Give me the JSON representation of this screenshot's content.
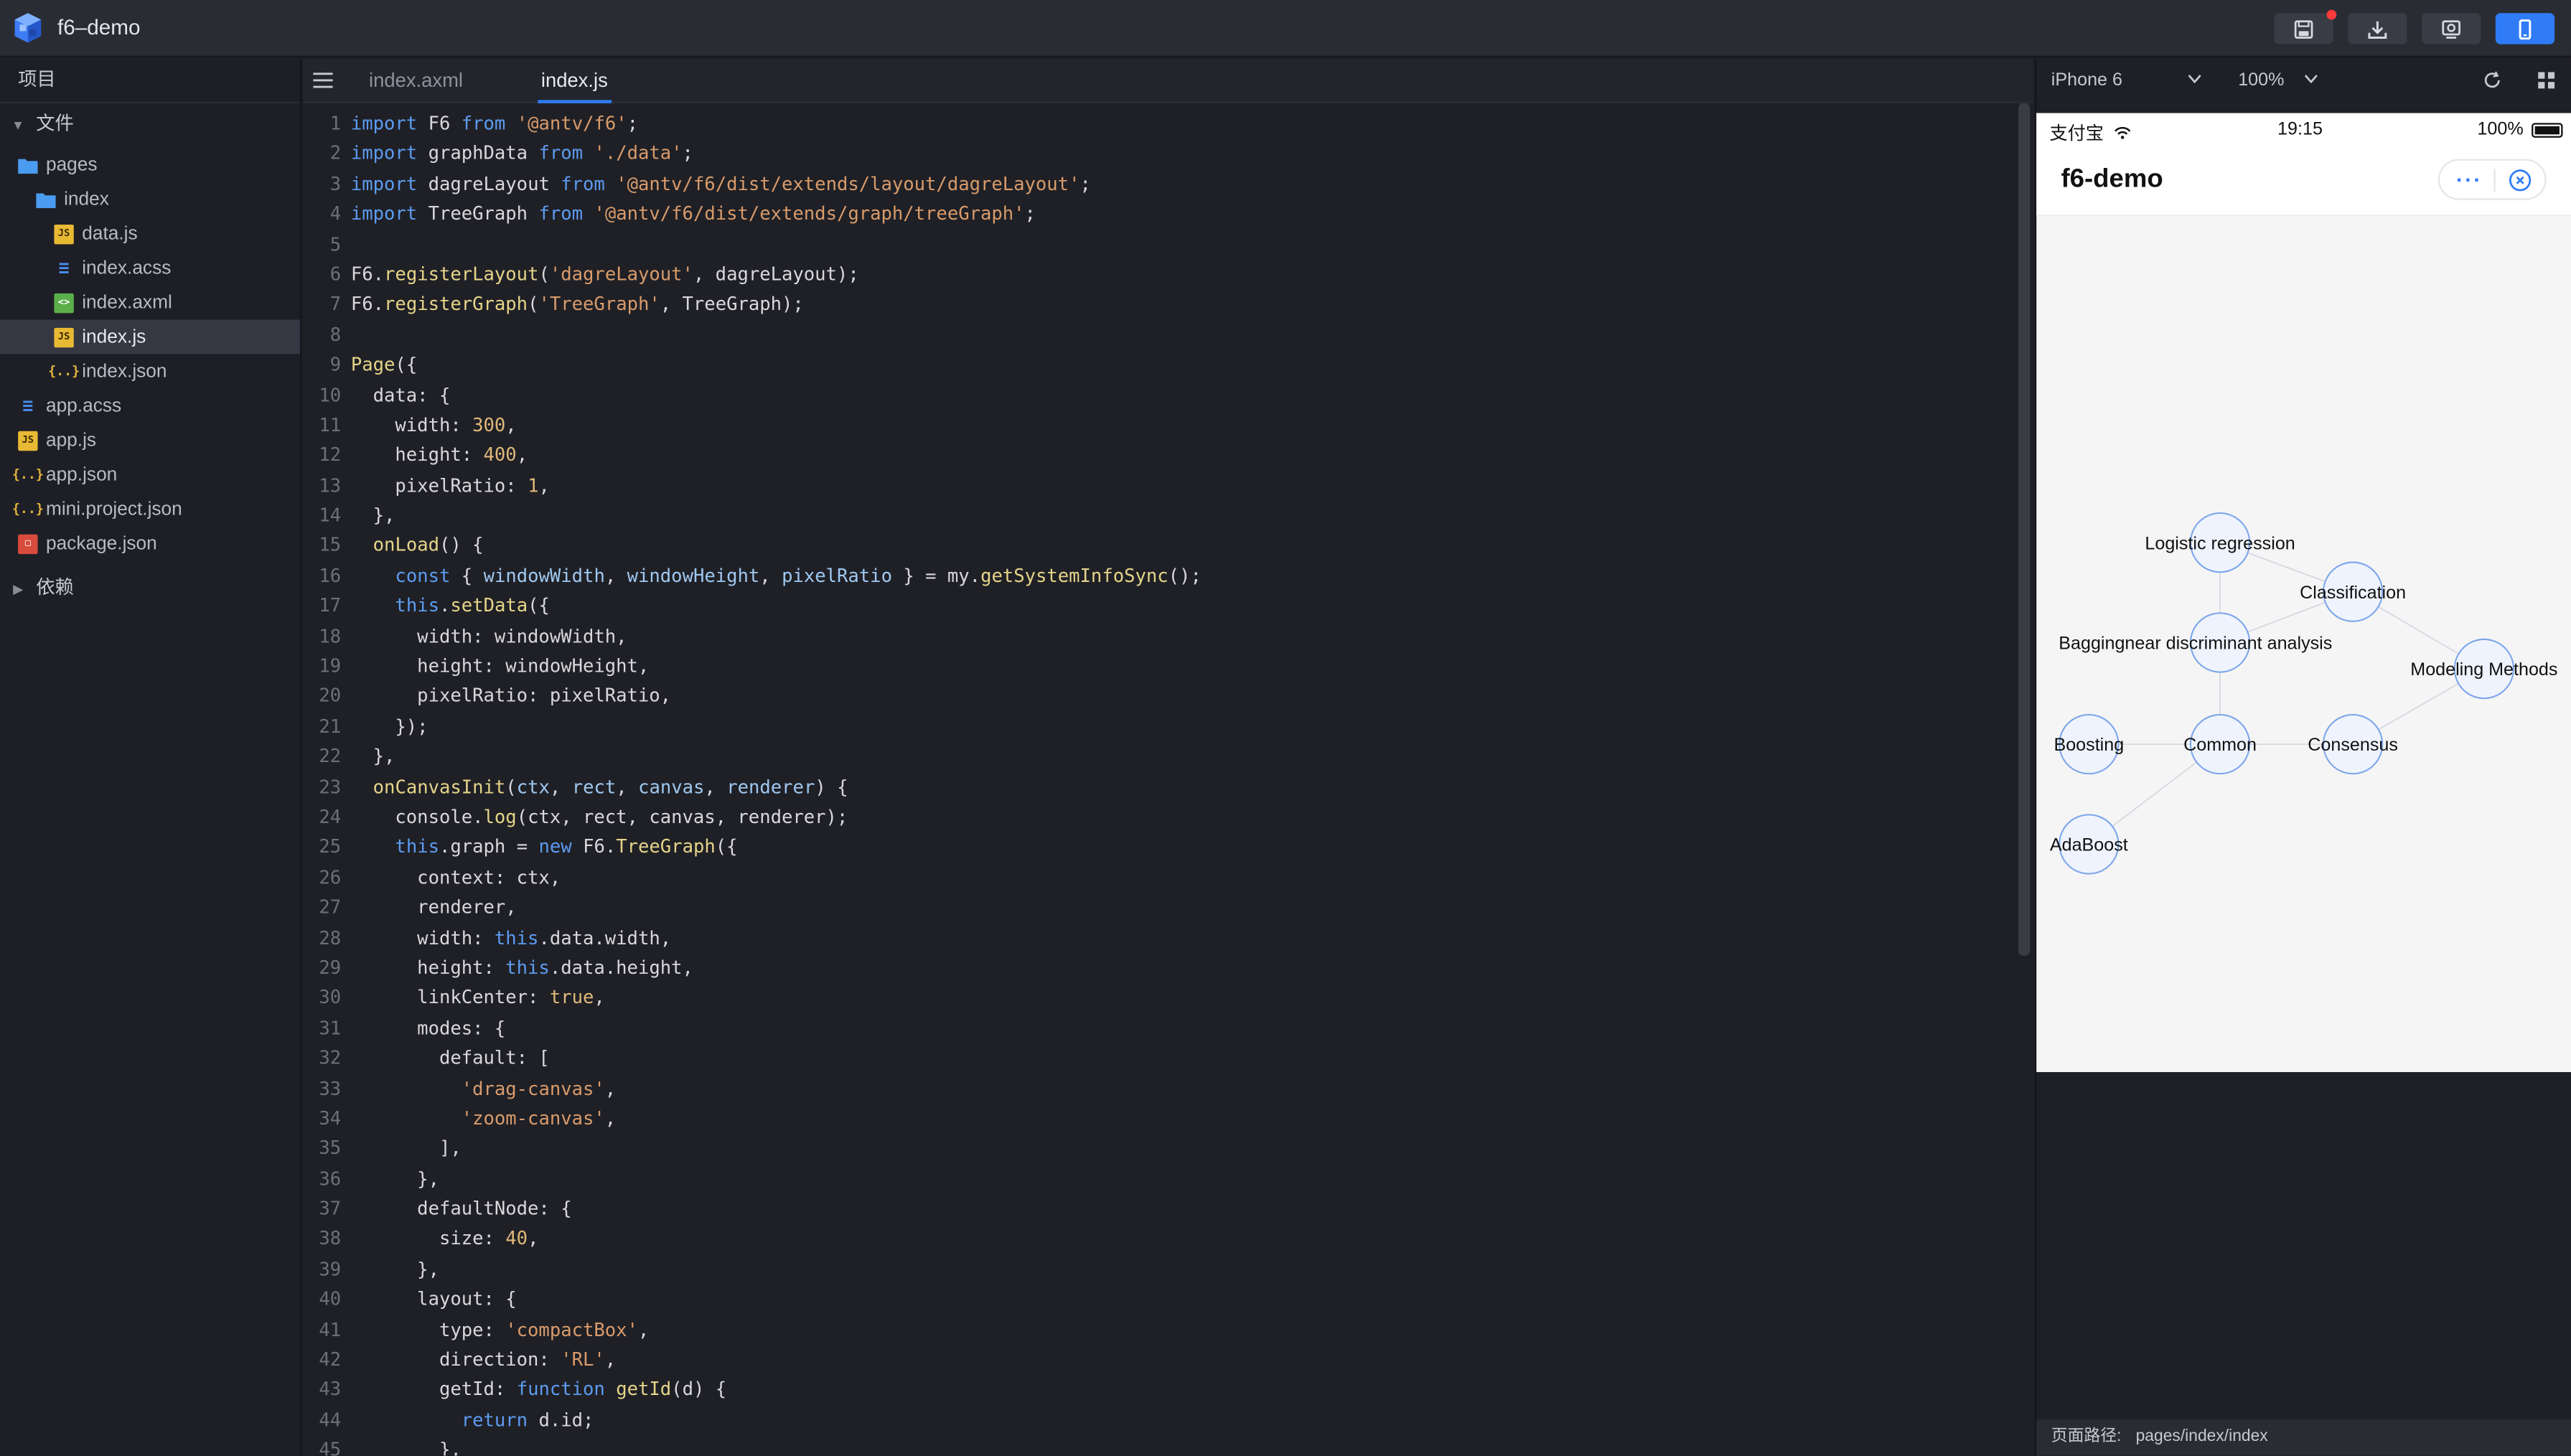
{
  "app": {
    "title": "f6–demo"
  },
  "sidebar": {
    "header": "项目",
    "files_section": "文件",
    "deps_section": "依赖",
    "items": [
      {
        "label": "pages",
        "icon": "folder-icon",
        "depth": 0
      },
      {
        "label": "index",
        "icon": "folder-icon",
        "depth": 1
      },
      {
        "label": "data.js",
        "icon": "js-file-icon",
        "depth": 2
      },
      {
        "label": "index.acss",
        "icon": "css-file-icon",
        "depth": 2
      },
      {
        "label": "index.axml",
        "icon": "axml-file-icon",
        "depth": 2
      },
      {
        "label": "index.js",
        "icon": "js-file-icon",
        "depth": 2,
        "selected": true
      },
      {
        "label": "index.json",
        "icon": "json-file-icon",
        "depth": 2
      },
      {
        "label": "app.acss",
        "icon": "css-file-icon",
        "depth": 0
      },
      {
        "label": "app.js",
        "icon": "js-file-icon",
        "depth": 0
      },
      {
        "label": "app.json",
        "icon": "json-file-icon",
        "depth": 0
      },
      {
        "label": "mini.project.json",
        "icon": "json-file-icon",
        "depth": 0
      },
      {
        "label": "package.json",
        "icon": "package-file-icon",
        "depth": 0
      }
    ]
  },
  "editor": {
    "tabs": [
      {
        "label": "index.axml",
        "active": false
      },
      {
        "label": "index.js",
        "active": true
      }
    ],
    "lines": [
      [
        [
          "k",
          "import"
        ],
        [
          "p",
          " F6 "
        ],
        [
          "k",
          "from"
        ],
        [
          "p",
          " "
        ],
        [
          "s",
          "'@antv/f6'"
        ],
        [
          "p",
          ";"
        ]
      ],
      [
        [
          "k",
          "import"
        ],
        [
          "p",
          " graphData "
        ],
        [
          "k",
          "from"
        ],
        [
          "p",
          " "
        ],
        [
          "s",
          "'./data'"
        ],
        [
          "p",
          ";"
        ]
      ],
      [
        [
          "k",
          "import"
        ],
        [
          "p",
          " dagreLayout "
        ],
        [
          "k",
          "from"
        ],
        [
          "p",
          " "
        ],
        [
          "s",
          "'@antv/f6/dist/extends/layout/dagreLayout'"
        ],
        [
          "p",
          ";"
        ]
      ],
      [
        [
          "k",
          "import"
        ],
        [
          "p",
          " TreeGraph "
        ],
        [
          "k",
          "from"
        ],
        [
          "p",
          " "
        ],
        [
          "s",
          "'@antv/f6/dist/extends/graph/treeGraph'"
        ],
        [
          "p",
          ";"
        ]
      ],
      [],
      [
        [
          "p",
          "F6."
        ],
        [
          "f",
          "registerLayout"
        ],
        [
          "p",
          "("
        ],
        [
          "s",
          "'dagreLayout'"
        ],
        [
          "p",
          ", dagreLayout);"
        ]
      ],
      [
        [
          "p",
          "F6."
        ],
        [
          "f",
          "registerGraph"
        ],
        [
          "p",
          "("
        ],
        [
          "s",
          "'TreeGraph'"
        ],
        [
          "p",
          ", TreeGraph);"
        ]
      ],
      [],
      [
        [
          "f",
          "Page"
        ],
        [
          "p",
          "({"
        ]
      ],
      [
        [
          "p",
          "  data: {"
        ]
      ],
      [
        [
          "p",
          "    width: "
        ],
        [
          "n",
          "300"
        ],
        [
          "p",
          ","
        ]
      ],
      [
        [
          "p",
          "    height: "
        ],
        [
          "n",
          "400"
        ],
        [
          "p",
          ","
        ]
      ],
      [
        [
          "p",
          "    pixelRatio: "
        ],
        [
          "n",
          "1"
        ],
        [
          "p",
          ","
        ]
      ],
      [
        [
          "p",
          "  },"
        ]
      ],
      [
        [
          "p",
          "  "
        ],
        [
          "f",
          "onLoad"
        ],
        [
          "p",
          "() {"
        ]
      ],
      [
        [
          "p",
          "    "
        ],
        [
          "k",
          "const"
        ],
        [
          "p",
          " { "
        ],
        [
          "v",
          "windowWidth"
        ],
        [
          "p",
          ", "
        ],
        [
          "v",
          "windowHeight"
        ],
        [
          "p",
          ", "
        ],
        [
          "v",
          "pixelRatio"
        ],
        [
          "p",
          " } = my."
        ],
        [
          "f",
          "getSystemInfoSync"
        ],
        [
          "p",
          "();"
        ]
      ],
      [
        [
          "p",
          "    "
        ],
        [
          "k",
          "this"
        ],
        [
          "p",
          "."
        ],
        [
          "f",
          "setData"
        ],
        [
          "p",
          "({"
        ]
      ],
      [
        [
          "p",
          "      width: windowWidth,"
        ]
      ],
      [
        [
          "p",
          "      height: windowHeight,"
        ]
      ],
      [
        [
          "p",
          "      pixelRatio: pixelRatio,"
        ]
      ],
      [
        [
          "p",
          "    });"
        ]
      ],
      [
        [
          "p",
          "  },"
        ]
      ],
      [
        [
          "p",
          "  "
        ],
        [
          "f",
          "onCanvasInit"
        ],
        [
          "p",
          "("
        ],
        [
          "v",
          "ctx"
        ],
        [
          "p",
          ", "
        ],
        [
          "v",
          "rect"
        ],
        [
          "p",
          ", "
        ],
        [
          "v",
          "canvas"
        ],
        [
          "p",
          ", "
        ],
        [
          "v",
          "renderer"
        ],
        [
          "p",
          ") {"
        ]
      ],
      [
        [
          "p",
          "    console."
        ],
        [
          "f",
          "log"
        ],
        [
          "p",
          "(ctx, rect, canvas, renderer);"
        ]
      ],
      [
        [
          "p",
          "    "
        ],
        [
          "k",
          "this"
        ],
        [
          "p",
          ".graph = "
        ],
        [
          "k",
          "new"
        ],
        [
          "p",
          " F6."
        ],
        [
          "f",
          "TreeGraph"
        ],
        [
          "p",
          "({"
        ]
      ],
      [
        [
          "p",
          "      context: ctx,"
        ]
      ],
      [
        [
          "p",
          "      renderer,"
        ]
      ],
      [
        [
          "p",
          "      width: "
        ],
        [
          "k",
          "this"
        ],
        [
          "p",
          ".data.width,"
        ]
      ],
      [
        [
          "p",
          "      height: "
        ],
        [
          "k",
          "this"
        ],
        [
          "p",
          ".data.height,"
        ]
      ],
      [
        [
          "p",
          "      linkCenter: "
        ],
        [
          "n",
          "true"
        ],
        [
          "p",
          ","
        ]
      ],
      [
        [
          "p",
          "      modes: {"
        ]
      ],
      [
        [
          "p",
          "        default: ["
        ]
      ],
      [
        [
          "p",
          "          "
        ],
        [
          "s",
          "'drag-canvas'"
        ],
        [
          "p",
          ","
        ]
      ],
      [
        [
          "p",
          "          "
        ],
        [
          "s",
          "'zoom-canvas'"
        ],
        [
          "p",
          ","
        ]
      ],
      [
        [
          "p",
          "        ],"
        ]
      ],
      [
        [
          "p",
          "      },"
        ]
      ],
      [
        [
          "p",
          "      defaultNode: {"
        ]
      ],
      [
        [
          "p",
          "        size: "
        ],
        [
          "n",
          "40"
        ],
        [
          "p",
          ","
        ]
      ],
      [
        [
          "p",
          "      },"
        ]
      ],
      [
        [
          "p",
          "      layout: {"
        ]
      ],
      [
        [
          "p",
          "        type: "
        ],
        [
          "s",
          "'compactBox'"
        ],
        [
          "p",
          ","
        ]
      ],
      [
        [
          "p",
          "        direction: "
        ],
        [
          "s",
          "'RL'"
        ],
        [
          "p",
          ","
        ]
      ],
      [
        [
          "p",
          "        getId: "
        ],
        [
          "k",
          "function"
        ],
        [
          "p",
          " "
        ],
        [
          "f",
          "getId"
        ],
        [
          "p",
          "(d) {"
        ]
      ],
      [
        [
          "p",
          "          "
        ],
        [
          "k",
          "return"
        ],
        [
          "p",
          " d.id;"
        ]
      ],
      [
        [
          "p",
          "        },"
        ]
      ]
    ]
  },
  "simulator": {
    "device": "iPhone 6",
    "zoom": "100%",
    "status": {
      "carrier": "支付宝",
      "time": "19:15",
      "battery": "100%"
    },
    "nav_title": "f6-demo",
    "graph": {
      "nodes": [
        {
          "label": "Logistic regression"
        },
        {
          "label": "Classification"
        },
        {
          "label": "Baggingnear discriminant analysis"
        },
        {
          "label": "Modeling Methods"
        },
        {
          "label": "Boosting"
        },
        {
          "label": "Common"
        },
        {
          "label": "Consensus"
        },
        {
          "label": "AdaBoost"
        }
      ]
    },
    "path_label": "页面路径:",
    "path_value": "pages/index/index"
  }
}
